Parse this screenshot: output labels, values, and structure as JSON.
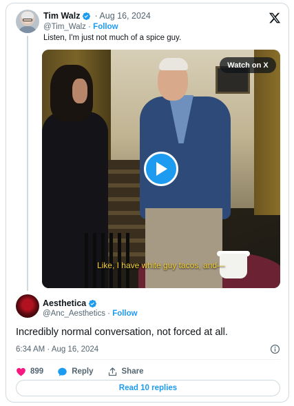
{
  "quoted_post": {
    "author_name": "Tim Walz",
    "date": "· Aug 16, 2024",
    "handle": "@Tim_Walz",
    "handle_separator": " · ",
    "follow_label": "Follow",
    "text": "Listen, I'm just not much of a spice guy."
  },
  "video": {
    "watch_label": "Watch on X",
    "subtitle": "Like, I have white guy tacos, and—"
  },
  "post": {
    "author_name": "Aesthetica",
    "handle": "@Anc_Aesthetics",
    "handle_separator": " · ",
    "follow_label": "Follow",
    "text": "Incredibly normal conversation, not forced at all.",
    "timestamp": "6:34 AM · Aug 16, 2024"
  },
  "actions": {
    "like_count": "899",
    "reply_label": "Reply",
    "share_label": "Share"
  },
  "read_replies_label": "Read 10 replies",
  "colors": {
    "accent": "#1d9bf0",
    "like": "#f91880",
    "text_primary": "#0f1419",
    "text_secondary": "#536471"
  },
  "icons": {
    "verified": "verified-badge-icon",
    "brand": "x-logo-icon",
    "play": "play-icon",
    "info": "info-icon",
    "like": "heart-icon",
    "reply": "reply-bubble-icon",
    "share": "share-icon"
  }
}
